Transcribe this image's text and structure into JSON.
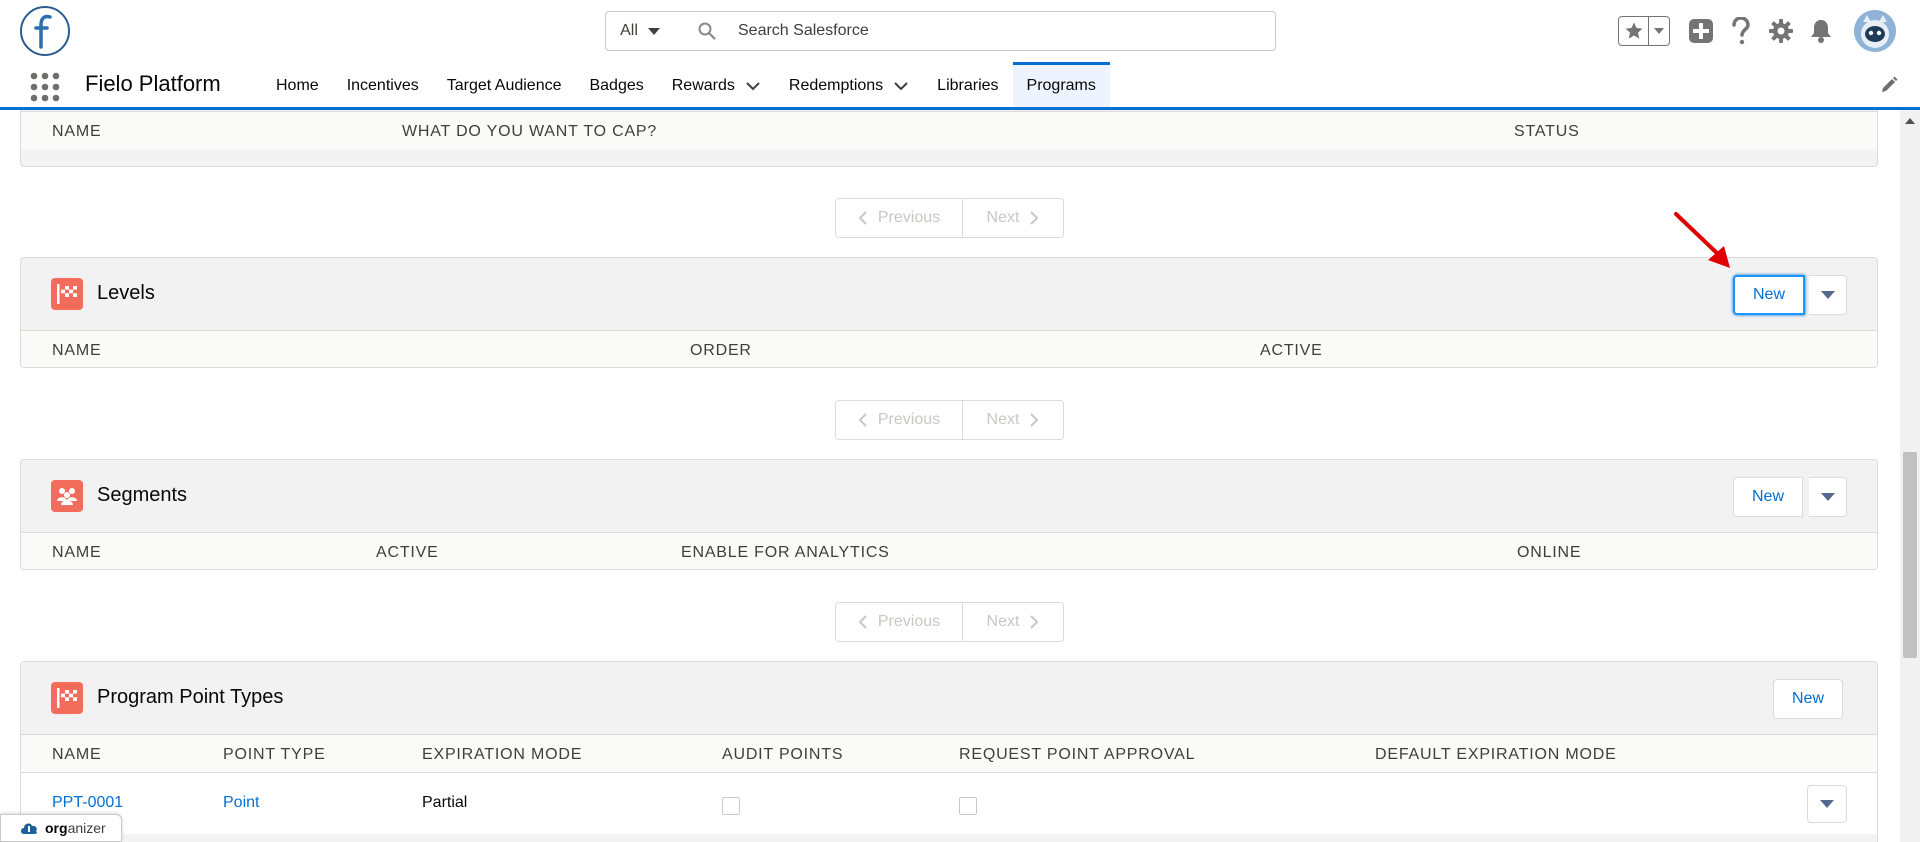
{
  "header": {
    "search_scope": "All",
    "search_placeholder": "Search Salesforce"
  },
  "nav": {
    "app_name": "Fielo Platform",
    "items": [
      {
        "label": "Home",
        "has_menu": false
      },
      {
        "label": "Incentives",
        "has_menu": false
      },
      {
        "label": "Target Audience",
        "has_menu": false
      },
      {
        "label": "Badges",
        "has_menu": false
      },
      {
        "label": "Rewards",
        "has_menu": true
      },
      {
        "label": "Redemptions",
        "has_menu": true
      },
      {
        "label": "Libraries",
        "has_menu": false
      },
      {
        "label": "Programs",
        "has_menu": false,
        "active": true
      }
    ]
  },
  "caps": {
    "columns": [
      "NAME",
      "WHAT DO YOU WANT TO CAP?",
      "STATUS"
    ]
  },
  "pager": {
    "previous": "Previous",
    "next": "Next"
  },
  "levels": {
    "title": "Levels",
    "new_label": "New",
    "columns": [
      "NAME",
      "ORDER",
      "ACTIVE"
    ]
  },
  "segments": {
    "title": "Segments",
    "new_label": "New",
    "columns": [
      "NAME",
      "ACTIVE",
      "ENABLE FOR ANALYTICS",
      "ONLINE"
    ]
  },
  "point_types": {
    "title": "Program Point Types",
    "new_label": "New",
    "columns": [
      "NAME",
      "POINT TYPE",
      "EXPIRATION MODE",
      "AUDIT POINTS",
      "REQUEST POINT APPROVAL",
      "DEFAULT EXPIRATION MODE"
    ],
    "rows": [
      {
        "name": "PPT-0001",
        "point_type": "Point",
        "expiration_mode": "Partial",
        "audit_points": false,
        "request_point_approval": false,
        "default_expiration_mode": ""
      }
    ]
  },
  "organizer": {
    "bold": "org",
    "rest": "anizer"
  },
  "colors": {
    "brand": "#0070d2",
    "card_icon": "#f26c5c",
    "annotation": "#e00000"
  }
}
